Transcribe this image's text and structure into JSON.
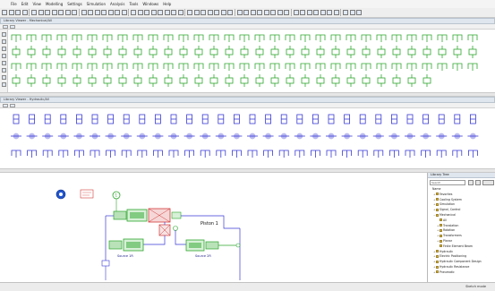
{
  "app": {
    "menu": [
      "File",
      "Edit",
      "View",
      "Modelling",
      "Settings",
      "Simulation",
      "Analysis",
      "Tools",
      "Windows",
      "Help"
    ]
  },
  "library_top": {
    "title": "Library Viewer - Mechanical/All",
    "color": "#2ea62e"
  },
  "library_bottom": {
    "title": "Library Viewer - Hydraulic/All",
    "color": "#3a3ad6"
  },
  "model": {
    "label_piston": "Piston 1",
    "label_source_a": "Source 1R",
    "label_source_b": "Source 2R",
    "component_color": "#2ea62e",
    "hydraulic_color": "#3a3ad6",
    "highlight_color": "#d23a3a"
  },
  "tree": {
    "title": "Library Tree",
    "search_placeholder": "Search",
    "items": [
      {
        "label": "Name",
        "depth": 0,
        "expander": ""
      },
      {
        "label": "Favorites",
        "depth": 1,
        "expander": "+"
      },
      {
        "label": "Cooling System",
        "depth": 1,
        "expander": "+"
      },
      {
        "label": "Simulation",
        "depth": 1,
        "expander": "+"
      },
      {
        "label": "Signal, Control",
        "depth": 1,
        "expander": "+"
      },
      {
        "label": "Mechanical",
        "depth": 1,
        "expander": "−"
      },
      {
        "label": "All",
        "depth": 2,
        "expander": ""
      },
      {
        "label": "Translation",
        "depth": 2,
        "expander": "+"
      },
      {
        "label": "Rotation",
        "depth": 2,
        "expander": "+"
      },
      {
        "label": "Transformers",
        "depth": 2,
        "expander": "+"
      },
      {
        "label": "Planar",
        "depth": 2,
        "expander": "+"
      },
      {
        "label": "Finite Element Beam",
        "depth": 2,
        "expander": ""
      },
      {
        "label": "Hydraulic",
        "depth": 1,
        "expander": "+"
      },
      {
        "label": "Electric Positioning",
        "depth": 1,
        "expander": "+"
      },
      {
        "label": "Hydraulic Component Design",
        "depth": 1,
        "expander": "+"
      },
      {
        "label": "Hydraulic Resistance",
        "depth": 1,
        "expander": "+"
      },
      {
        "label": "Pneumatic",
        "depth": 1,
        "expander": "+"
      }
    ]
  },
  "status": {
    "mode": "Sketch mode"
  }
}
